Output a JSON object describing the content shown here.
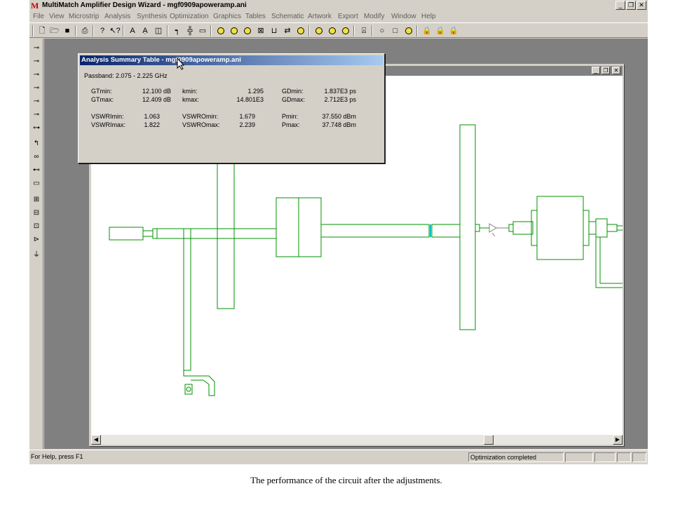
{
  "window": {
    "title": "MultiMatch Amplifier Design Wizard - mgf0909apoweramp.ani",
    "logo_letter": "M",
    "controls": {
      "minimize": "_",
      "restore": "❐",
      "close": "✕"
    }
  },
  "menu": [
    "File",
    "View",
    "Microstrip",
    "Analysis",
    "Synthesis",
    "Optimization",
    "Graphics",
    "Tables",
    "Schematic",
    "Artwork",
    "Export",
    "Modify",
    "Window",
    "Help"
  ],
  "toolbar": {
    "icons": [
      "new-file-icon",
      "open-folder-icon",
      "save-icon",
      "print-icon",
      "help-icon",
      "context-help-icon",
      "element-a-icon",
      "element-a2-icon",
      "element-d-icon",
      "element-tee-icon",
      "element-cross-icon",
      "element-box-icon",
      "circle-o-icon",
      "circle-f-icon",
      "circle-target-icon",
      "box-x-icon",
      "element-bracket-icon",
      "swap-icon",
      "chart-icon",
      "circle-y-icon",
      "circle-g-icon",
      "circle-dot-icon",
      "element-lambda-icon",
      "circle-plain-icon",
      "square-plain-icon",
      "circle-plain2-icon",
      "lock-icon",
      "lock2-icon",
      "lock3-icon"
    ]
  },
  "dialog": {
    "title": "Analysis Summary Table - mgf0909apoweramp.ani",
    "passband": "Passband: 2.075 - 2.225 GHz",
    "rows": [
      [
        {
          "label": "GTmin:",
          "value": "12.100 dB"
        },
        {
          "label": "kmin:",
          "value": "1.295"
        },
        {
          "label": "GDmin:",
          "value": "1.837E3 ps"
        }
      ],
      [
        {
          "label": "GTmax:",
          "value": "12.409 dB"
        },
        {
          "label": "kmax:",
          "value": "14.801E3"
        },
        {
          "label": "GDmax:",
          "value": "2.712E3 ps"
        }
      ],
      [
        {
          "label": "VSWRImin:",
          "value": "1.063"
        },
        {
          "label": "VSWROmin:",
          "value": "1.679"
        },
        {
          "label": "Pmin:",
          "value": "37.550 dBm"
        }
      ],
      [
        {
          "label": "VSWRImax:",
          "value": "1.822"
        },
        {
          "label": "VSWROmax:",
          "value": "2.239"
        },
        {
          "label": "Pmax:",
          "value": "37.748 dBm"
        }
      ]
    ]
  },
  "statusbar": {
    "help": "For Help, press F1",
    "status": "Optimization completed"
  },
  "caption": "The performance of the circuit after the adjustments.",
  "colors": {
    "circuit": "#009000",
    "accent_line": "#00c0c0",
    "title_gradient_start": "#0a246a"
  }
}
